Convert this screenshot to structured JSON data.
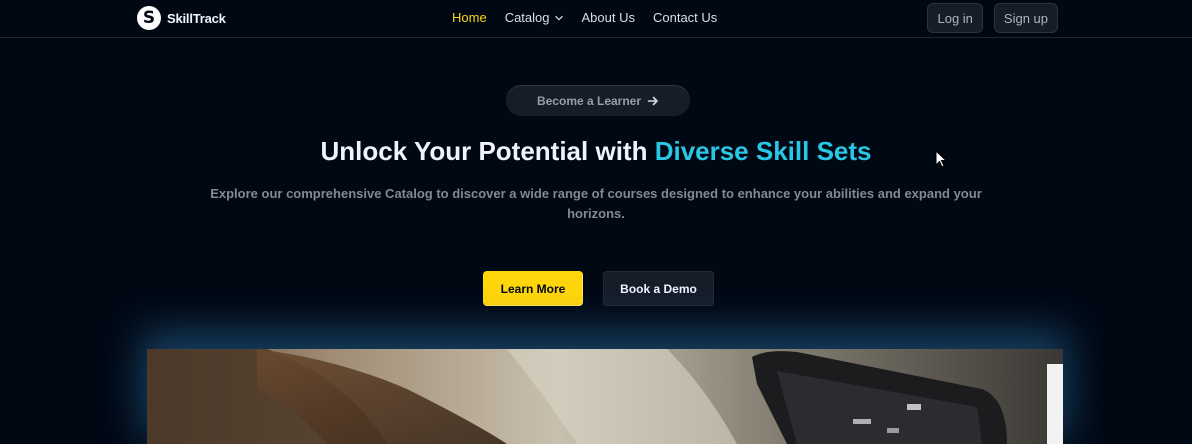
{
  "brand": {
    "logo_letter": "S",
    "name": "SkillTrack"
  },
  "nav": {
    "items": [
      {
        "label": "Home",
        "active": true
      },
      {
        "label": "Catalog",
        "has_dropdown": true
      },
      {
        "label": "About Us"
      },
      {
        "label": "Contact Us"
      }
    ]
  },
  "auth": {
    "login_label": "Log in",
    "signup_label": "Sign up"
  },
  "hero": {
    "pill_label": "Become a Learner",
    "title_prefix": "Unlock Your Potential with ",
    "title_highlight": "Diverse Skill Sets",
    "subtitle": "Explore our comprehensive Catalog to discover a wide range of courses designed to enhance your abilities and expand your horizons.",
    "primary_cta": "Learn More",
    "secondary_cta": "Book a Demo"
  },
  "icons": {
    "pill_arrow": "arrow-right-icon",
    "catalog_chevron": "chevron-down-icon",
    "logo": "logo-icon",
    "cursor": "mouse-cursor-icon"
  },
  "colors": {
    "background": "#000814",
    "accent_yellow": "#ffd60a",
    "highlight_cyan": "#29c7e5",
    "surface": "#161d29"
  }
}
